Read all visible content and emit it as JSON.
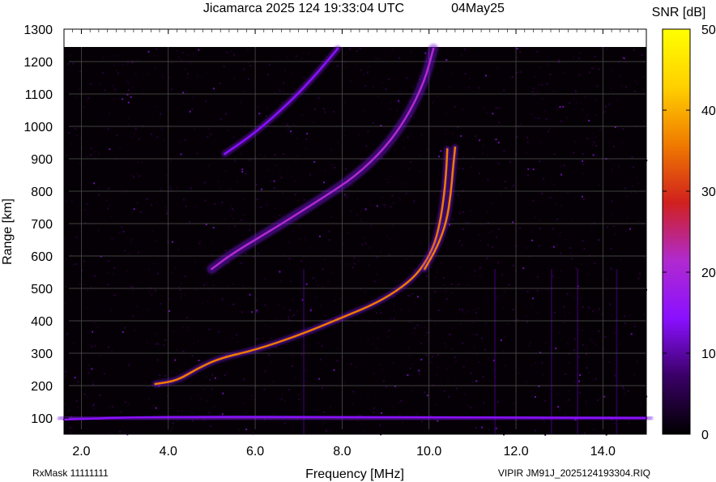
{
  "chart_data": {
    "type": "heatmap",
    "title": "Jicamarca 2025 124 19:33:04 UTC",
    "date_label": "04May25",
    "xlabel": "Frequency [MHz]",
    "ylabel": "Range [km]",
    "xlim": [
      1.6,
      15.0
    ],
    "ylim": [
      50,
      1300
    ],
    "x_ticks": [
      {
        "value": 2.0,
        "label": "2.0"
      },
      {
        "value": 4.0,
        "label": "4.0"
      },
      {
        "value": 6.0,
        "label": "6.0"
      },
      {
        "value": 8.0,
        "label": "8.0"
      },
      {
        "value": 10.0,
        "label": "10.0"
      },
      {
        "value": 12.0,
        "label": "12.0"
      },
      {
        "value": 14.0,
        "label": "14.0"
      }
    ],
    "y_ticks": [
      {
        "value": 100,
        "label": "100"
      },
      {
        "value": 200,
        "label": "200"
      },
      {
        "value": 300,
        "label": "300"
      },
      {
        "value": 400,
        "label": "400"
      },
      {
        "value": 500,
        "label": "500"
      },
      {
        "value": 600,
        "label": "600"
      },
      {
        "value": 700,
        "label": "700"
      },
      {
        "value": 800,
        "label": "800"
      },
      {
        "value": 900,
        "label": "900"
      },
      {
        "value": 1000,
        "label": "1000"
      },
      {
        "value": 1100,
        "label": "1100"
      },
      {
        "value": 1200,
        "label": "1200"
      },
      {
        "value": 1300,
        "label": "1300"
      }
    ],
    "grid": true,
    "colorbar": {
      "label": "SNR [dB]",
      "range": [
        0,
        50
      ],
      "ticks": [
        {
          "value": 0,
          "label": "0"
        },
        {
          "value": 10,
          "label": "10"
        },
        {
          "value": 20,
          "label": "20"
        },
        {
          "value": 30,
          "label": "30"
        },
        {
          "value": 40,
          "label": "40"
        },
        {
          "value": 50,
          "label": "50"
        }
      ],
      "colors": [
        "#000000",
        "#3a0066",
        "#8a10ff",
        "#b02ad0",
        "#d0201e",
        "#f07a00",
        "#ffd000",
        "#ffff00"
      ]
    },
    "traces": [
      {
        "id": "f-layer-1hop",
        "snr_db": 38,
        "points": [
          [
            3.7,
            205
          ],
          [
            4.2,
            215
          ],
          [
            4.7,
            255
          ],
          [
            5.2,
            285
          ],
          [
            6.0,
            310
          ],
          [
            7.0,
            355
          ],
          [
            8.0,
            410
          ],
          [
            8.8,
            455
          ],
          [
            9.4,
            505
          ],
          [
            9.8,
            555
          ],
          [
            10.1,
            625
          ],
          [
            10.25,
            700
          ],
          [
            10.35,
            790
          ],
          [
            10.4,
            870
          ],
          [
            10.42,
            930
          ]
        ]
      },
      {
        "id": "f-layer-1hop-secondary",
        "snr_db": 33,
        "points": [
          [
            9.9,
            560
          ],
          [
            10.2,
            630
          ],
          [
            10.4,
            705
          ],
          [
            10.5,
            790
          ],
          [
            10.55,
            870
          ],
          [
            10.6,
            935
          ]
        ]
      },
      {
        "id": "multi-hop",
        "snr_db": 20,
        "points": [
          [
            5.0,
            560
          ],
          [
            5.5,
            610
          ],
          [
            6.5,
            690
          ],
          [
            7.5,
            775
          ],
          [
            8.3,
            845
          ],
          [
            9.0,
            935
          ],
          [
            9.5,
            1030
          ],
          [
            9.9,
            1140
          ],
          [
            10.1,
            1240
          ]
        ]
      },
      {
        "id": "third-hop",
        "snr_db": 14,
        "points": [
          [
            5.3,
            915
          ],
          [
            6.0,
            980
          ],
          [
            6.8,
            1075
          ],
          [
            7.4,
            1160
          ],
          [
            7.9,
            1240
          ]
        ]
      },
      {
        "id": "e-region",
        "snr_db": 16,
        "points": [
          [
            1.6,
            95
          ],
          [
            3.0,
            102
          ],
          [
            5.0,
            104
          ],
          [
            8.0,
            103
          ],
          [
            11.0,
            102
          ],
          [
            15.0,
            100
          ]
        ]
      }
    ]
  },
  "footer": {
    "rx_mask": "RxMask 11111111",
    "file_name": "VIPIR  JM91J_2025124193304.RIQ"
  }
}
